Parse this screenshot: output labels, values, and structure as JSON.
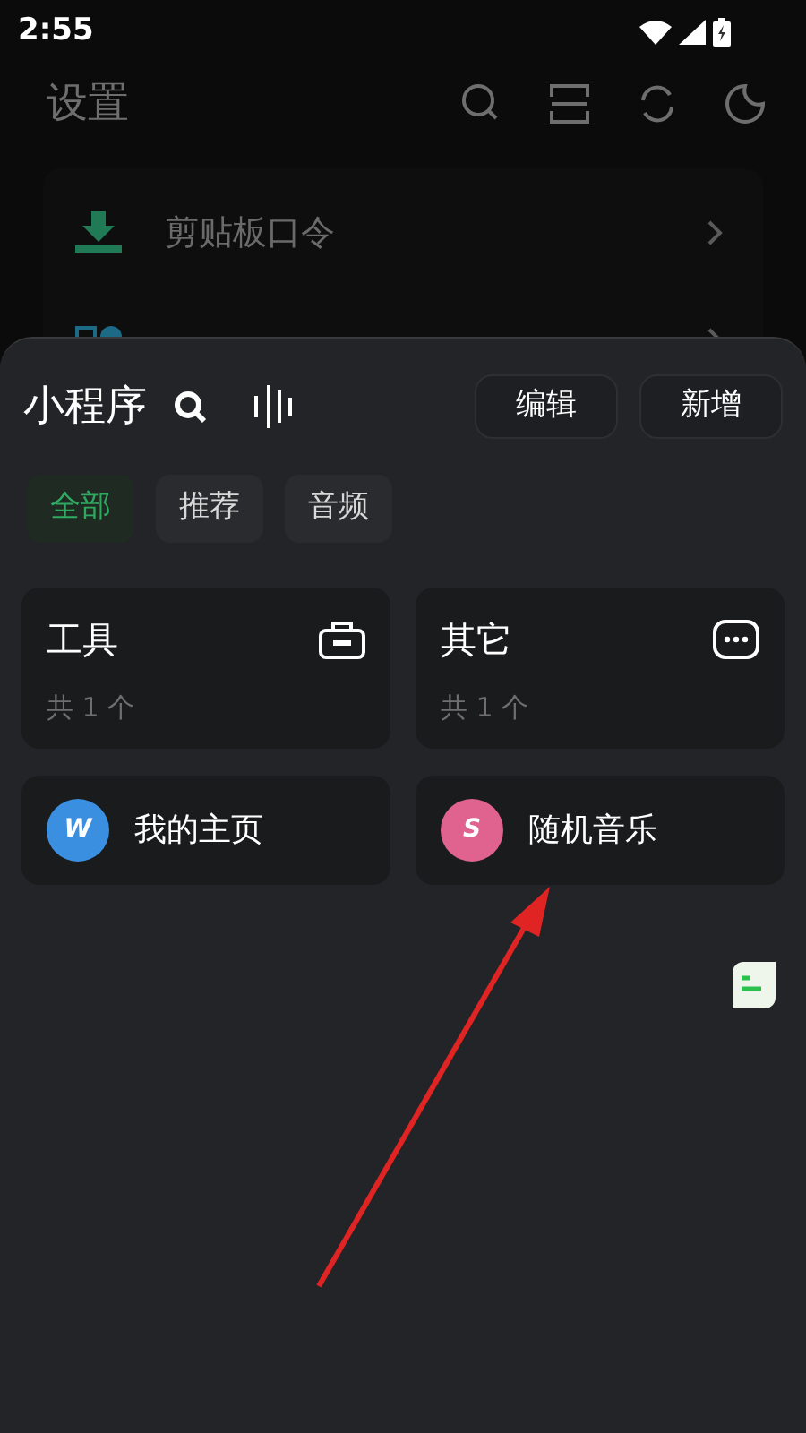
{
  "status_bar": {
    "time": "2:55"
  },
  "background": {
    "title": "设置",
    "items": [
      {
        "label": "剪贴板口令",
        "kind": "download"
      },
      {
        "kind": "apps"
      }
    ]
  },
  "sheet": {
    "title": "小程序",
    "buttons": [
      "编辑",
      "新增"
    ],
    "tabs": [
      {
        "label": "全部",
        "selected": true
      },
      {
        "label": "推荐",
        "selected": false
      },
      {
        "label": "音频",
        "selected": false
      }
    ],
    "categories": [
      {
        "name": "工具",
        "count": "共 1 个",
        "kind": "toolbox"
      },
      {
        "name": "其它",
        "count": "共 1 个",
        "kind": "more"
      }
    ],
    "apps": [
      {
        "name": "我的主页",
        "badge": "W",
        "color": "#3b8fe0"
      },
      {
        "name": "随机音乐",
        "badge": "S",
        "color": "#e0628e"
      }
    ]
  }
}
